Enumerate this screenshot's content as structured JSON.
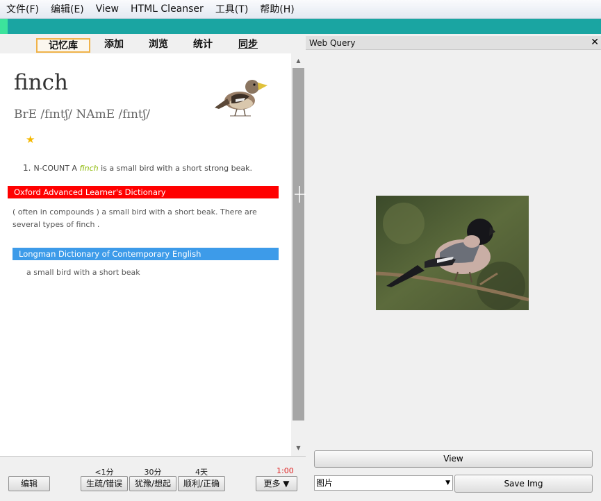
{
  "menu": [
    "文件(F)",
    "编辑(E)",
    "View",
    "HTML Cleanser",
    "工具(T)",
    "帮助(H)"
  ],
  "tabs": [
    "记忆库",
    "添加",
    "浏览",
    "统计",
    "同步"
  ],
  "entry": {
    "headword": "finch",
    "phonetic": "BrE /fɪntʃ/ NAmE /fɪntʃ/",
    "star": "★",
    "def1_num": "1.",
    "def1_pre": "N-COUNT A ",
    "def1_word": "finch",
    "def1_post": " is a small bird with a short strong beak.",
    "oxford_title": "Oxford Advanced Learner's Dictionary",
    "oxford_def": "( often in compounds ) a small bird with a short beak. There are several types of finch .",
    "longman_title": "Longman Dictionary of Contemporary English",
    "longman_def": "a small bird with a short beak"
  },
  "bottom": {
    "edit_label": "编辑",
    "intervals": [
      "<1分",
      "30分",
      "4天"
    ],
    "answers": [
      "生疏/错误",
      "犹豫/想起",
      "顺利/正确"
    ],
    "timer": "1:00",
    "more_label": "更多 ▼"
  },
  "web_query": {
    "title": "Web Query",
    "close": "✕",
    "view_label": "View",
    "select_value": "图片",
    "save_label": "Save Img"
  },
  "colors": {
    "teal": "#1aa5a2",
    "oxford_red": "#ff0000",
    "longman_blue": "#3d9be9",
    "highlight_green": "#8ab800",
    "timer_red": "#e02020"
  }
}
